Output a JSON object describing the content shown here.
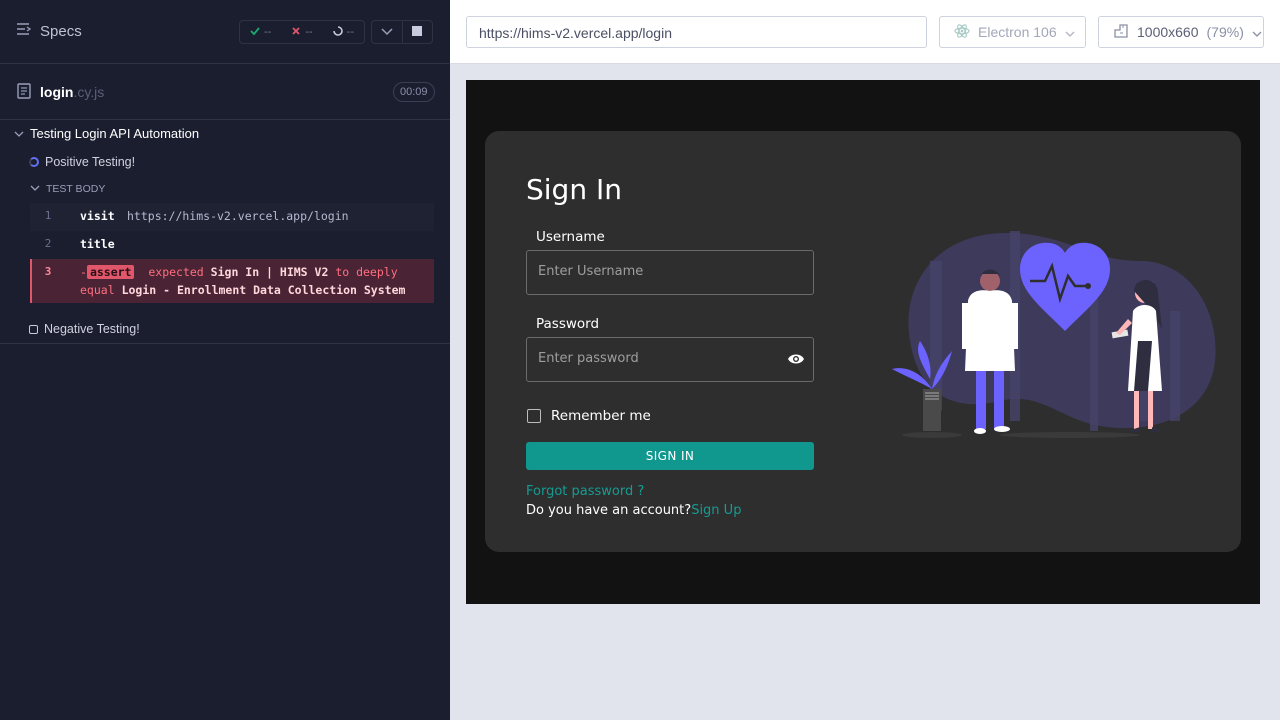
{
  "runner": {
    "specs_label": "Specs",
    "stats": {
      "passed": "--",
      "failed": "--",
      "pending": "--"
    },
    "spec_file": {
      "name": "login",
      "ext": ".cy.js",
      "duration": "00:09"
    },
    "suite": {
      "title": "Testing Login API Automation",
      "tests": [
        {
          "title": "Positive Testing!",
          "state": "running"
        },
        {
          "title": "Negative Testing!",
          "state": "pending"
        }
      ],
      "section_label": "TEST BODY",
      "commands": [
        {
          "num": "1",
          "name": "visit",
          "message": "https://hims-v2.vercel.app/login"
        },
        {
          "num": "2",
          "name": "title",
          "message": ""
        },
        {
          "num": "3",
          "prefix": "-",
          "name": "assert",
          "message_parts": [
            "expected",
            "Sign In | HIMS V2",
            "to deeply",
            "equal",
            "Login - Enrollment Data Collection System"
          ]
        }
      ]
    }
  },
  "browser": {
    "url": "https://hims-v2.vercel.app/login",
    "browser_name": "Electron 106",
    "viewport": "1000x660",
    "zoom": "(79%)"
  },
  "app": {
    "title": "Sign In",
    "username_label": "Username",
    "username_placeholder": "Enter Username",
    "password_label": "Password",
    "password_placeholder": "Enter password",
    "remember_label": "Remember me",
    "signin_button": "SIGN IN",
    "forgot_link": "Forgot password ?",
    "account_question": "Do you have an account?",
    "signup_link": "Sign Up"
  },
  "colors": {
    "runner_bg": "#1b1e2e",
    "error_row": "#4a2434",
    "accent_teal": "#10988f",
    "illustration_purple": "#6c63ff"
  }
}
